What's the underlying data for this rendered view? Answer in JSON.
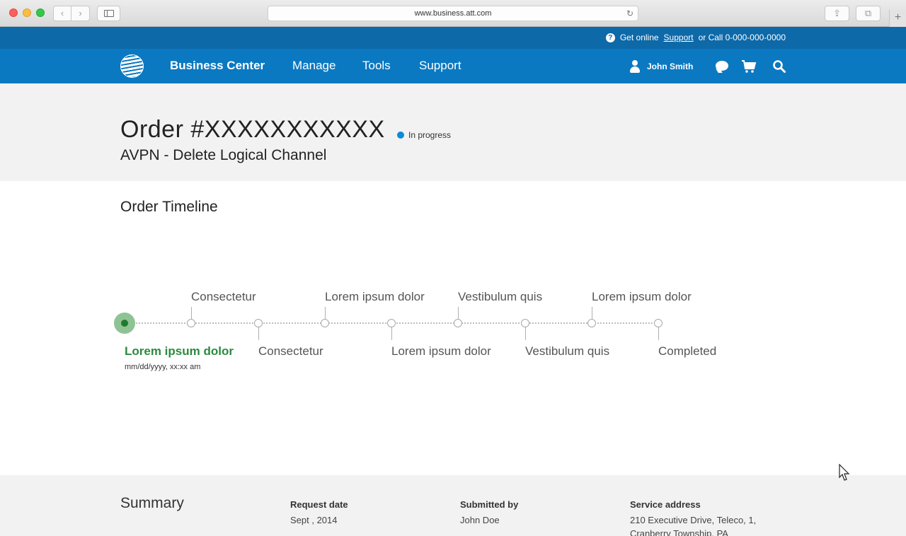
{
  "browser": {
    "url": "www.business.att.com",
    "back_glyph": "‹",
    "forward_glyph": "›",
    "reload_glyph": "↻",
    "share_glyph": "⇪",
    "tabs_glyph": "⧉",
    "new_tab_glyph": "+"
  },
  "utility_bar": {
    "help_glyph": "?",
    "prefix": "Get online",
    "support_link": "Support",
    "suffix": "or Call 0-000-000-0000"
  },
  "nav": {
    "brand": "Business Center",
    "items": [
      {
        "label": "Manage"
      },
      {
        "label": "Tools"
      },
      {
        "label": "Support"
      }
    ],
    "user_name": "John Smith",
    "icons": [
      "user-icon",
      "chat-icon",
      "cart-icon",
      "search-icon"
    ]
  },
  "order": {
    "title": "Order #XXXXXXXXXXX",
    "status": "In progress",
    "subtitle": "AVPN - Delete Logical Channel"
  },
  "timeline": {
    "title": "Order Timeline",
    "active_step": {
      "label": "Lorem ipsum dolor",
      "date": "mm/dd/yyyy, xx:xx am"
    },
    "steps": [
      {
        "label": "Lorem ipsum dolor",
        "position": "below",
        "active": true
      },
      {
        "label": "Consectetur",
        "position": "above"
      },
      {
        "label": "Consectetur",
        "position": "below"
      },
      {
        "label": "Lorem ipsum dolor",
        "position": "above"
      },
      {
        "label": "Lorem ipsum dolor",
        "position": "below"
      },
      {
        "label": "Vestibulum quis",
        "position": "above"
      },
      {
        "label": "Vestibulum quis",
        "position": "below"
      },
      {
        "label": "Lorem ipsum dolor",
        "position": "above"
      },
      {
        "label": "Completed",
        "position": "below"
      }
    ]
  },
  "summary": {
    "title": "Summary",
    "columns": [
      {
        "label": "Request date",
        "value": "Sept , 2014"
      },
      {
        "label": "Submitted by",
        "value": "John Doe"
      },
      {
        "label": "Service address",
        "value_line1": "210 Executive Drive, Teleco, 1,",
        "value_line2": "Cranberry Township, PA"
      }
    ]
  },
  "colors": {
    "utility_blue": "#0d69a8",
    "nav_blue": "#0b79c1",
    "status_blue": "#0b8ad6",
    "active_green": "#2b8a3e"
  }
}
